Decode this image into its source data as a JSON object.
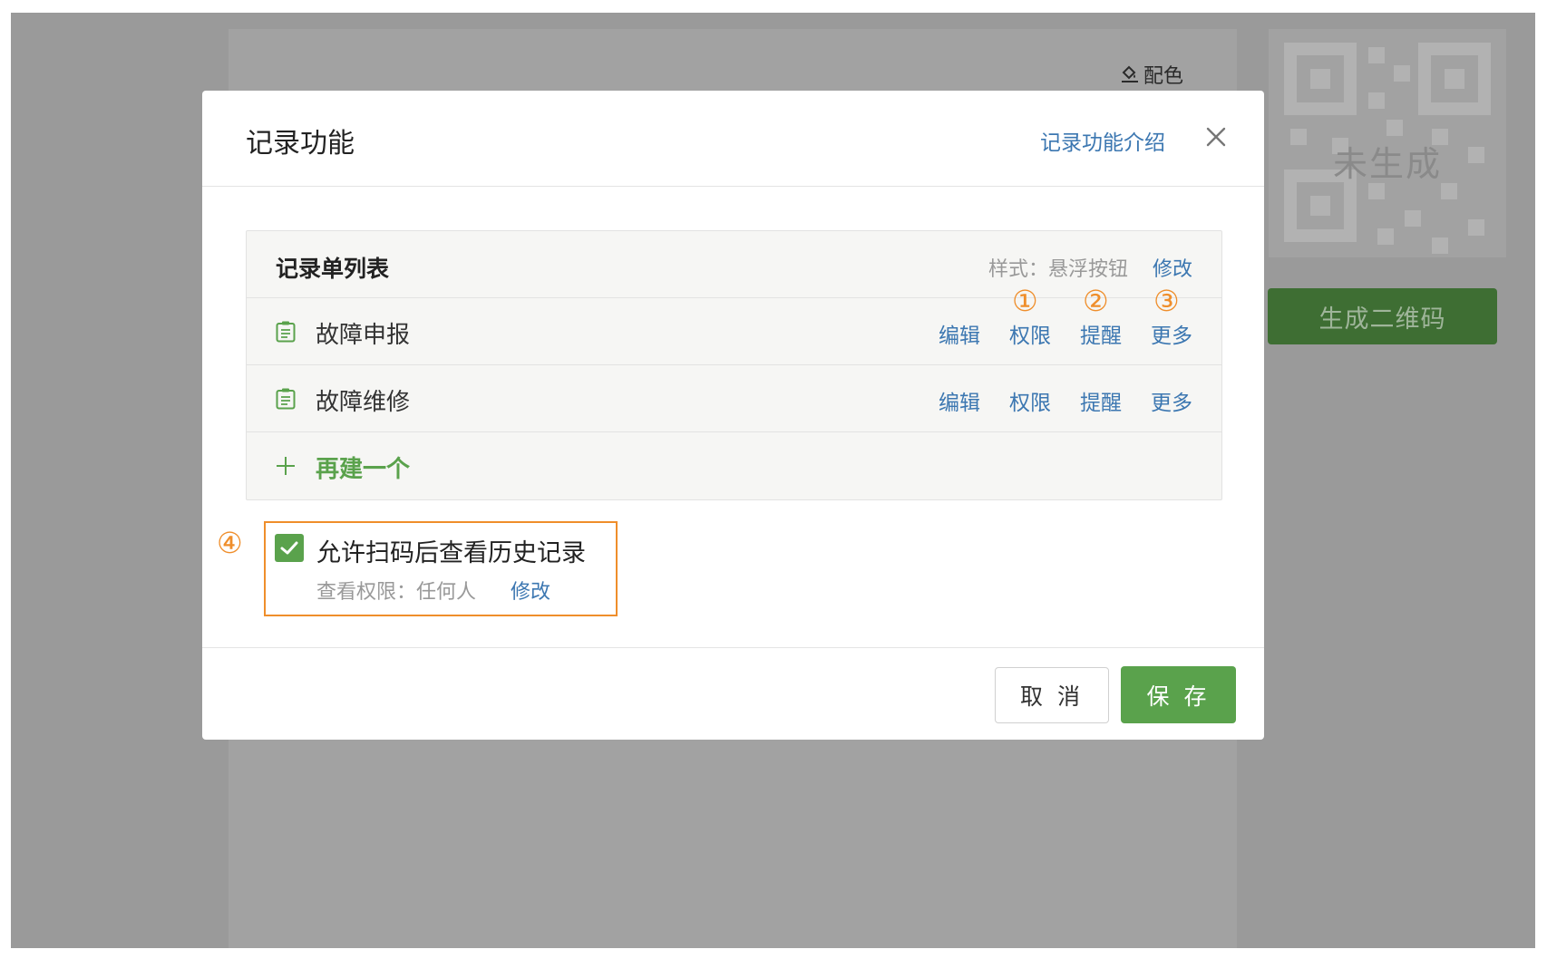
{
  "background": {
    "color_link": "配色",
    "qr_placeholder": "未生成",
    "generate_qr_button": "生成二维码"
  },
  "modal": {
    "title": "记录功能",
    "intro_link": "记录功能介绍",
    "list": {
      "title": "记录单列表",
      "style_label": "样式：悬浮按钮",
      "style_edit": "修改",
      "rows": [
        {
          "name": "故障申报",
          "actions": {
            "edit": "编辑",
            "permission": "权限",
            "remind": "提醒",
            "more": "更多"
          }
        },
        {
          "name": "故障维修",
          "actions": {
            "edit": "编辑",
            "permission": "权限",
            "remind": "提醒",
            "more": "更多"
          }
        }
      ],
      "add_label": "再建一个"
    },
    "annotations": [
      "①",
      "②",
      "③",
      "④"
    ],
    "history": {
      "checked": true,
      "label": "允许扫码后查看历史记录",
      "permission_label": "查看权限：任何人",
      "permission_edit": "修改"
    },
    "footer": {
      "cancel": "取 消",
      "save": "保 存"
    }
  },
  "colors": {
    "primary_green": "#5aa24c",
    "link_blue": "#3c77b1",
    "annotation_orange": "#ef8e2b",
    "overlay_gray": "#9a9a9a"
  },
  "icons": [
    "paint-bucket-icon",
    "close-icon",
    "document-icon",
    "plus-icon",
    "checkmark-icon"
  ]
}
